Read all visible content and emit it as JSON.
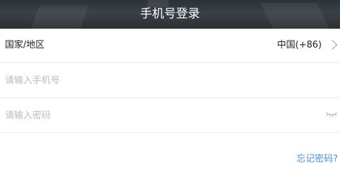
{
  "header": {
    "title": "手机号登录"
  },
  "country": {
    "label": "国家/地区",
    "value": "中国(+86)"
  },
  "phone": {
    "placeholder": "请输入手机号",
    "value": ""
  },
  "password": {
    "placeholder": "请输入密码",
    "value": ""
  },
  "forgot": {
    "label": "忘记密码?"
  },
  "icons": {
    "chevron": "chevron-right-icon",
    "eye": "eye-closed-icon"
  },
  "colors": {
    "header_bg": "#2b3238",
    "link": "#4a90c8",
    "placeholder": "#bbbbbb",
    "divider": "#ebebeb"
  }
}
